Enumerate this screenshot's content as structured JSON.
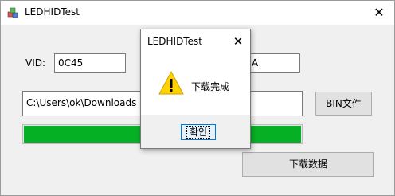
{
  "window": {
    "title": "LEDHIDTest",
    "icon": "app-cubes-icon",
    "close_glyph": "✕"
  },
  "form": {
    "vid_label": "VID:",
    "vid_value": "0C45",
    "pid_value_visible": "A",
    "file_path": "C:\\Users\\ok\\Downloads",
    "bin_button": "BIN文件",
    "progress_fraction": 1.0,
    "progress_color": "#06b025",
    "download_button": "下载数据"
  },
  "dialog": {
    "title": "LEDHIDTest",
    "close_glyph": "✕",
    "icon": "warning-icon",
    "message": "下载完成",
    "ok_button": "확인"
  }
}
